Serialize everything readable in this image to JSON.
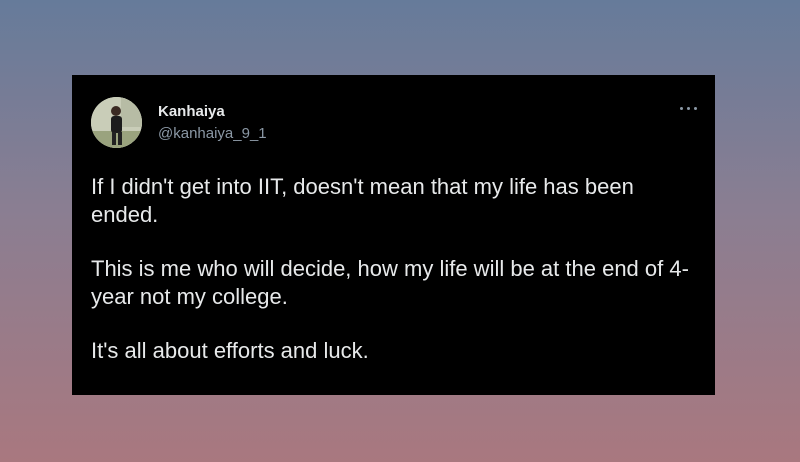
{
  "tweet": {
    "author_name": "Kanhaiya",
    "author_handle": "@kanhaiya_9_1",
    "more_icon": "more-horizontal-icon",
    "paragraphs": [
      "If I didn't get into IIT, doesn't mean that my life has been ended.",
      "This is me who will decide, how my life will be at the end of 4-year not my college.",
      "It's all about efforts and luck."
    ]
  },
  "colors": {
    "card_background": "#000000",
    "text_primary": "#e7e9ea",
    "text_secondary": "#8b98a5"
  }
}
